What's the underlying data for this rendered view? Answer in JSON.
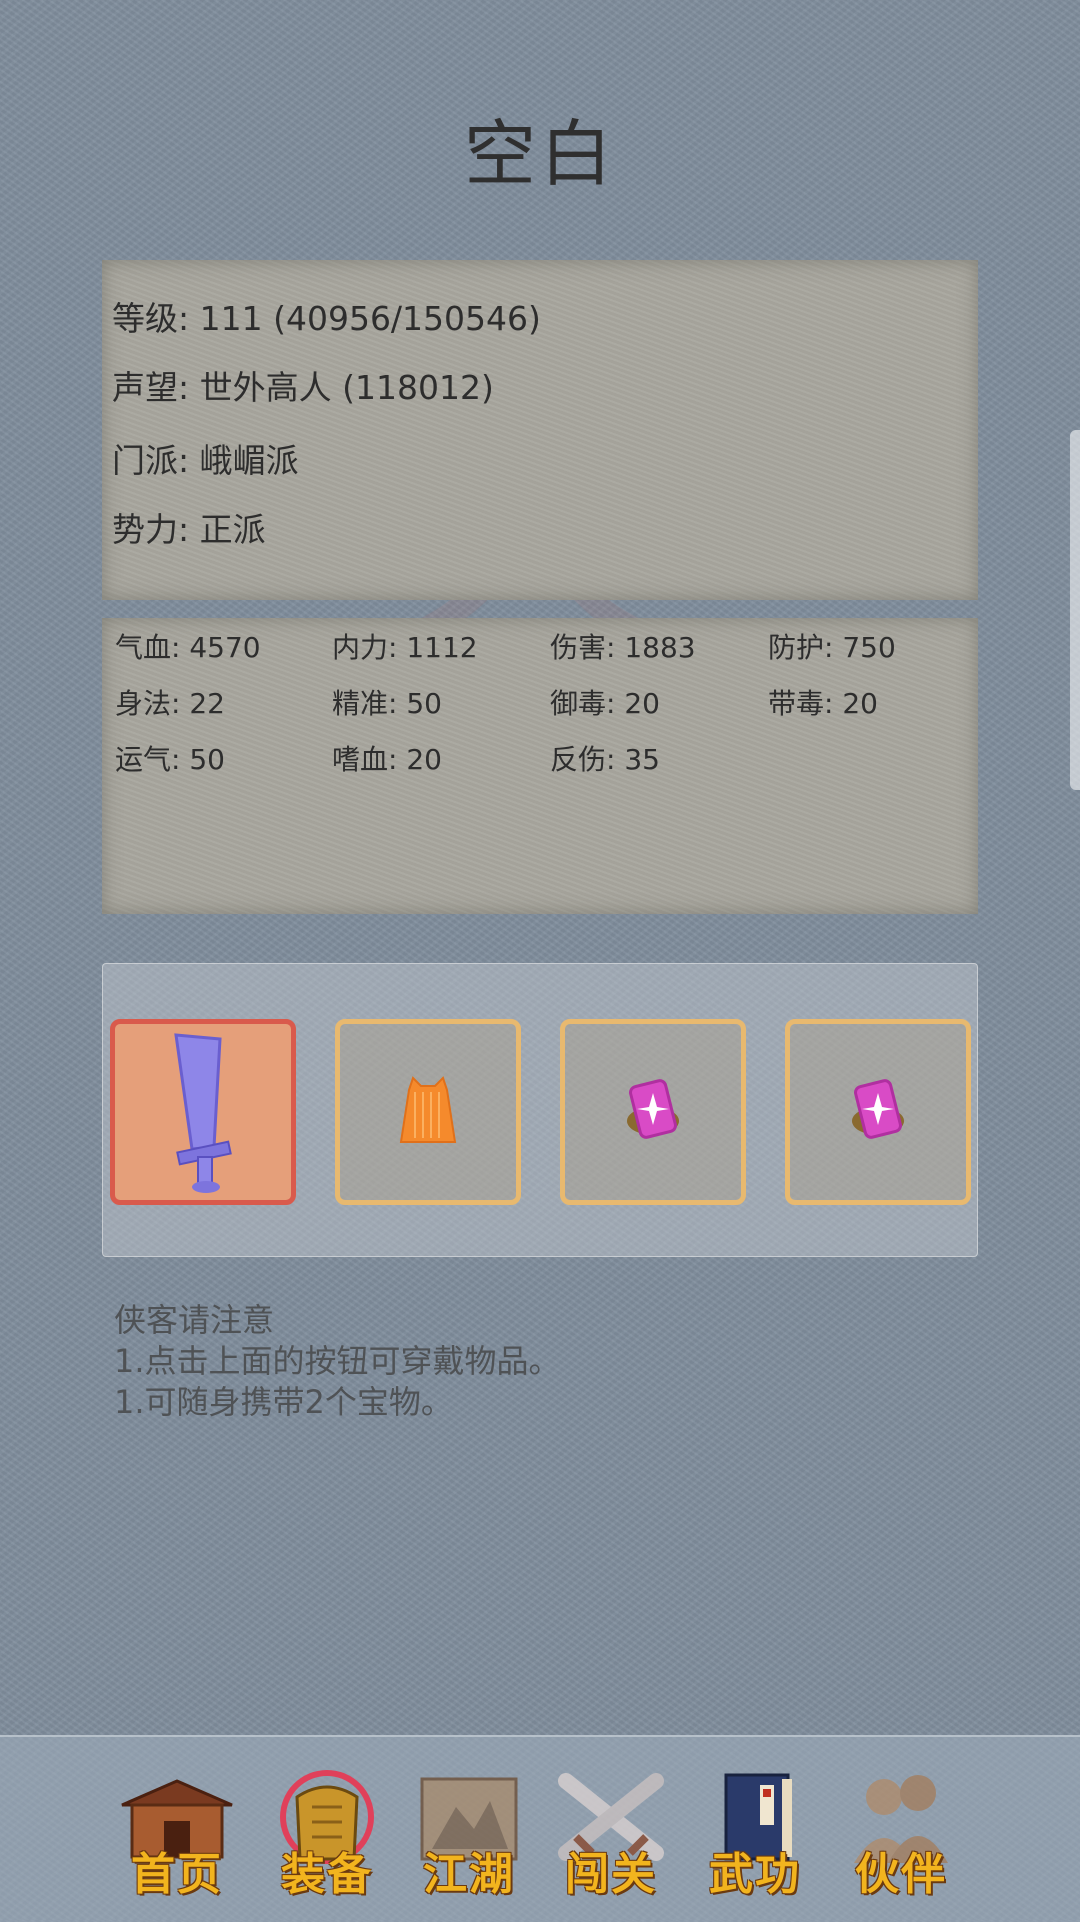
{
  "header": {
    "title": "空白"
  },
  "info": {
    "level": "等级: 111 (40956/150546)",
    "reputation": "声望: 世外高人 (118012)",
    "sect": "门派: 峨嵋派",
    "faction": "势力:  正派"
  },
  "stats": [
    "气血: 4570",
    "内力: 1112",
    "伤害: 1883",
    "防护: 750",
    "身法: 22",
    "精准: 50",
    "御毒: 20",
    "带毒: 20",
    "运气: 50",
    "嗜血: 20",
    "反伤: 35"
  ],
  "equipment": [
    {
      "icon": "sword-icon",
      "color": "#8e86e8",
      "selected": true
    },
    {
      "icon": "armor-icon",
      "color": "#f58a2c",
      "selected": false
    },
    {
      "icon": "treasure-icon",
      "color": "#d94bc6",
      "selected": false
    },
    {
      "icon": "treasure-icon",
      "color": "#d94bc6",
      "selected": false
    }
  ],
  "notes": {
    "heading": "侠客请注意",
    "line1": "1.点击上面的按钮可穿戴物品。",
    "line2": "1.可随身携带2个宝物。"
  },
  "nav": [
    {
      "label": "首页",
      "icon": "home-icon"
    },
    {
      "label": "装备",
      "icon": "equipment-icon"
    },
    {
      "label": "江湖",
      "icon": "jianghu-scroll-icon"
    },
    {
      "label": "闯关",
      "icon": "crossed-swords-icon"
    },
    {
      "label": "武功",
      "icon": "martial-book-icon"
    },
    {
      "label": "伙伴",
      "icon": "partners-icon"
    }
  ]
}
